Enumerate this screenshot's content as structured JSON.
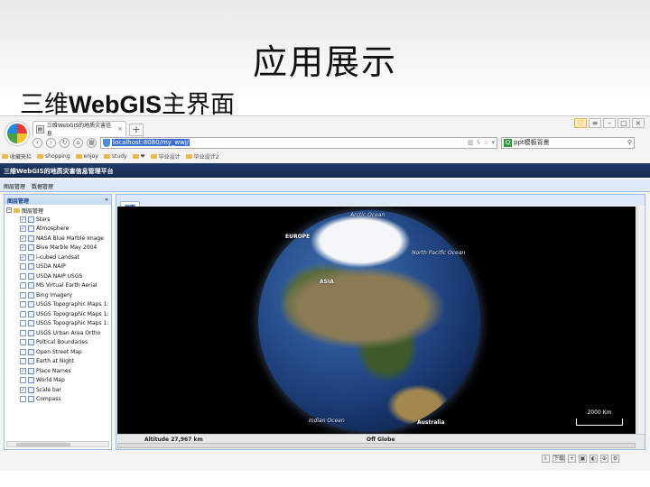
{
  "slide": {
    "title": "应用展示",
    "subtitle_prefix": "三维",
    "subtitle_bold": "WebGIS",
    "subtitle_suffix": "主界面"
  },
  "browser": {
    "tab_title": "三维WebGIS的地质灾害信息",
    "new_tab": "+",
    "url_text": "localhost:8080/my_wwj/",
    "search_text": "ppt模板背景",
    "bookmarks": [
      "收藏夹栏",
      "shopping",
      "enjoy",
      "study",
      "❤",
      "毕业设计",
      "毕业设计2"
    ]
  },
  "app": {
    "header_title": "三维WebGIS的地质灾害信息管理平台",
    "menu": [
      "图层管理",
      "数据管理"
    ],
    "panel_title": "图层管理",
    "tree_root": "图层管理",
    "layers": [
      {
        "name": "Stars",
        "checked": true
      },
      {
        "name": "Atmosphere",
        "checked": true
      },
      {
        "name": "NASA Blue Marble Image",
        "checked": true
      },
      {
        "name": "Blue Marble May 2004",
        "checked": true
      },
      {
        "name": "i-cubed Landsat",
        "checked": true
      },
      {
        "name": "USDA NAIP",
        "checked": false
      },
      {
        "name": "USDA NAIP USGS",
        "checked": false
      },
      {
        "name": "MS Virtual Earth Aerial",
        "checked": false
      },
      {
        "name": "Bing Imagery",
        "checked": false
      },
      {
        "name": "USGS Topographic Maps 1:2",
        "checked": false
      },
      {
        "name": "USGS Topographic Maps 1:1",
        "checked": false
      },
      {
        "name": "USGS Topographic Maps 1:2",
        "checked": false
      },
      {
        "name": "USGS Urban Area Ortho",
        "checked": false
      },
      {
        "name": "Poltical Boundaries",
        "checked": false
      },
      {
        "name": "Open Street Map",
        "checked": false
      },
      {
        "name": "Earth at Night",
        "checked": false
      },
      {
        "name": "Place Names",
        "checked": true
      },
      {
        "name": "World Map",
        "checked": false
      },
      {
        "name": "Scale bar",
        "checked": true
      },
      {
        "name": "Compass",
        "checked": false
      }
    ],
    "map_tab": "地图",
    "globe_labels": {
      "arctic": "Arctic Ocean",
      "europe": "EUROPE",
      "north_pacific": "North Pacific Ocean",
      "asia": "ASIA",
      "indian": "Indian Ocean",
      "australia": "Australia"
    },
    "scale_label": "2000 Km",
    "status_altitude": "Altitude  27,967 km",
    "status_globe": "Off Globe"
  },
  "taskbar": {
    "download": "下载"
  }
}
